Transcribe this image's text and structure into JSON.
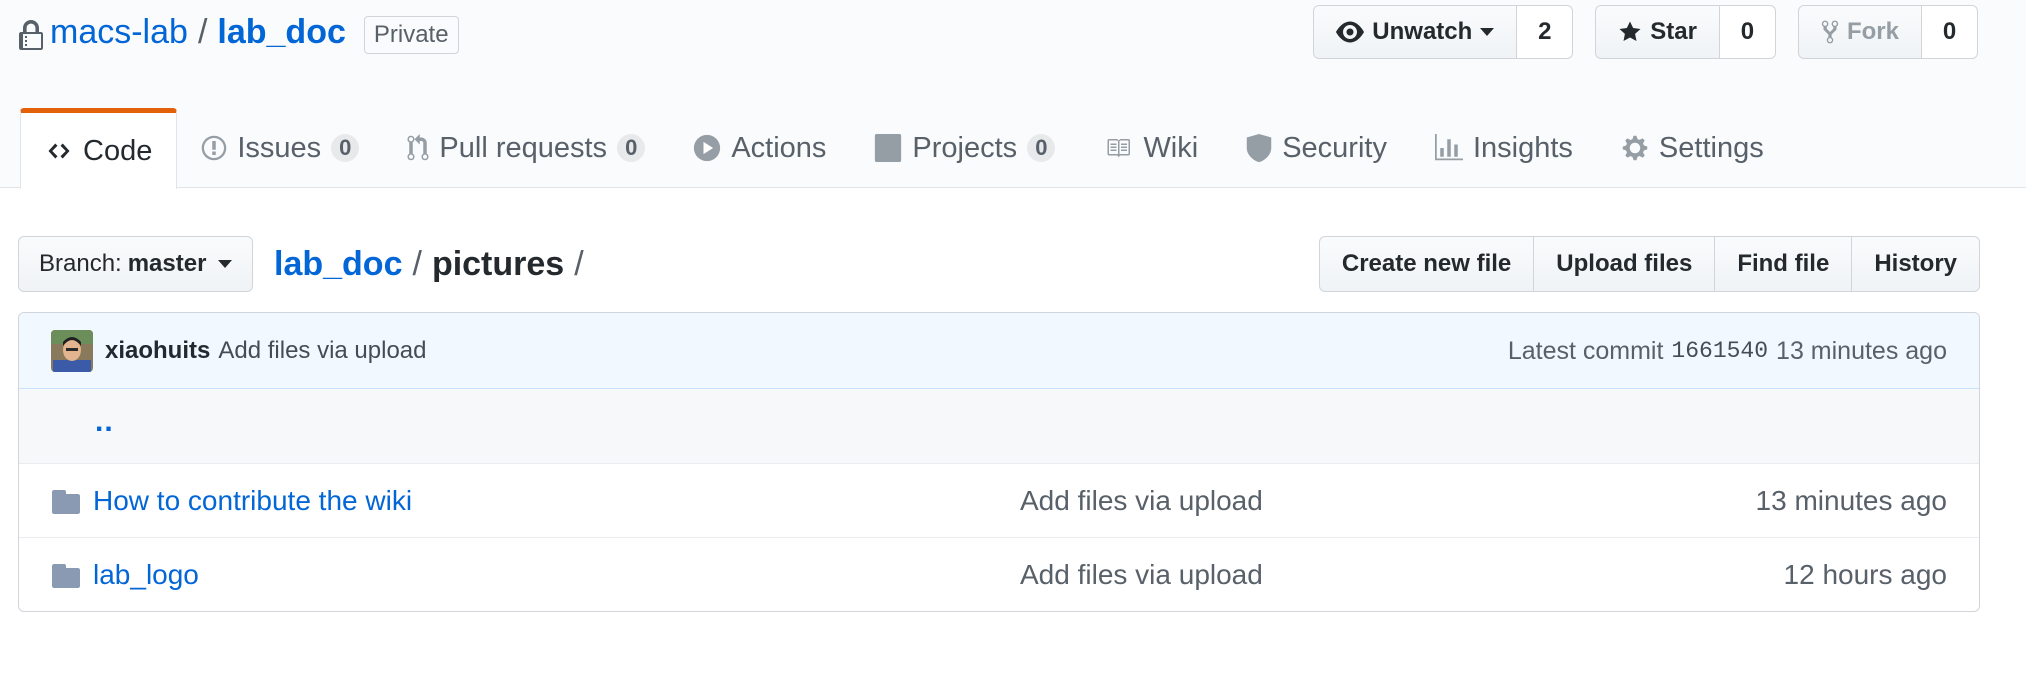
{
  "repo": {
    "owner": "macs-lab",
    "separator": "/",
    "name": "lab_doc",
    "visibility": "Private"
  },
  "actions": {
    "watch": {
      "label": "Unwatch",
      "count": "2"
    },
    "star": {
      "label": "Star",
      "count": "0"
    },
    "fork": {
      "label": "Fork",
      "count": "0"
    }
  },
  "tabs": [
    {
      "label": "Code",
      "icon": "code-icon",
      "selected": true
    },
    {
      "label": "Issues",
      "counter": "0",
      "icon": "issue-icon"
    },
    {
      "label": "Pull requests",
      "counter": "0",
      "icon": "pull-request-icon"
    },
    {
      "label": "Actions",
      "icon": "play-icon"
    },
    {
      "label": "Projects",
      "counter": "0",
      "icon": "project-icon"
    },
    {
      "label": "Wiki",
      "icon": "book-icon"
    },
    {
      "label": "Security",
      "icon": "shield-icon"
    },
    {
      "label": "Insights",
      "icon": "graph-icon"
    },
    {
      "label": "Settings",
      "icon": "gear-icon"
    }
  ],
  "branch": {
    "prefix": "Branch:",
    "name": "master"
  },
  "breadcrumb": {
    "root": "lab_doc",
    "sep": "/",
    "current": "pictures",
    "trailing": "/"
  },
  "file_nav": {
    "create": "Create new file",
    "upload": "Upload files",
    "find": "Find file",
    "history": "History"
  },
  "commit": {
    "author": "xiaohuits",
    "message": "Add files via upload",
    "latest_label": "Latest commit",
    "sha": "1661540",
    "age": "13 minutes ago"
  },
  "parent_link": "..",
  "files": [
    {
      "name": "How to contribute the wiki",
      "message": "Add files via upload",
      "age": "13 minutes ago",
      "icon": "folder-icon"
    },
    {
      "name": "lab_logo",
      "message": "Add files via upload",
      "age": "12 hours ago",
      "icon": "folder-icon"
    }
  ],
  "colors": {
    "link": "#0366d6",
    "tab_accent": "#e36209",
    "commit_bg": "#f1f8ff",
    "folder": "#79b8ff"
  }
}
